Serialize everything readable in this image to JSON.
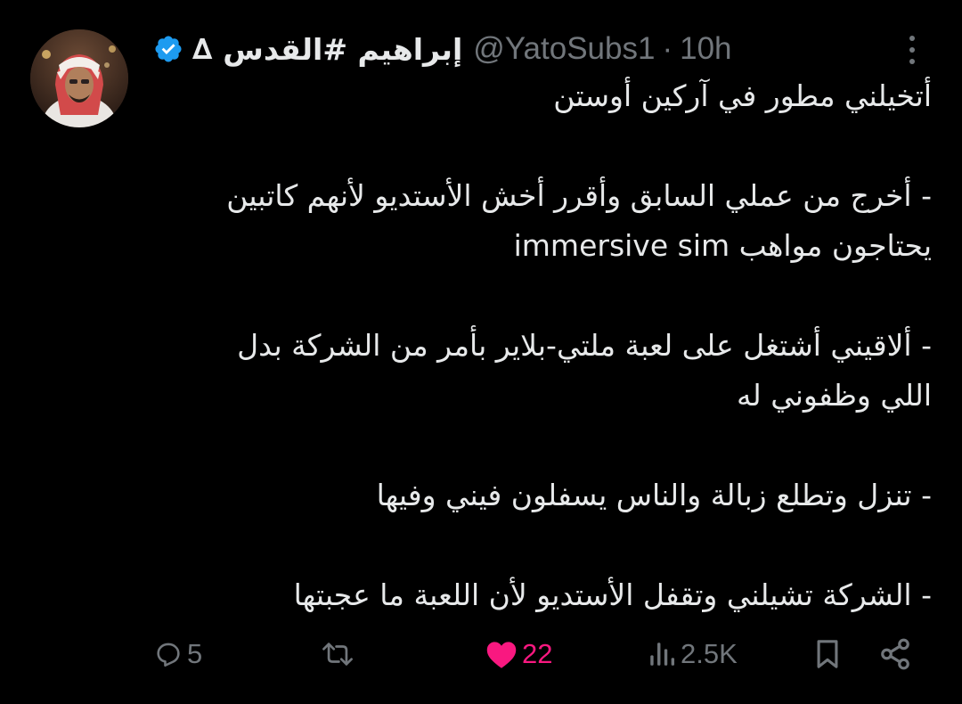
{
  "author": {
    "display_name": "إبراهيم #القدس",
    "badge_symbol": "∆",
    "verified": true,
    "handle": "@YatoSubs1",
    "separator": "·",
    "time": "10h"
  },
  "tweet": {
    "paragraphs": [
      [
        "أتخيلني مطور في آركين أوستن"
      ],
      [
        "- أخرج من عملي السابق وأقرر أخش الأستديو لأنهم كاتبين",
        "يحتاجون مواهب immersive sim"
      ],
      [
        "- ألاقيني أشتغل على لعبة ملتي-بلاير بأمر من الشركة بدل",
        "اللي وظفوني له"
      ],
      [
        "- تنزل وتطلع زبالة والناس يسفلون فيني وفيها"
      ],
      [
        "- الشركة تشيلني وتقفل الأستديو لأن اللعبة ما عجبتها"
      ]
    ]
  },
  "actions": {
    "replies": "5",
    "reposts": "",
    "likes": "22",
    "views": "2.5K"
  },
  "colors": {
    "background": "#000000",
    "text": "#e7e9ea",
    "muted": "#71767b",
    "like": "#f91880",
    "verified": "#1d9bf0"
  },
  "icons": {
    "reply": "reply-icon",
    "repost": "repost-icon",
    "like": "heart-icon",
    "views": "views-icon",
    "bookmark": "bookmark-icon",
    "share": "share-icon",
    "more": "more-icon",
    "verified": "verified-badge-icon"
  }
}
